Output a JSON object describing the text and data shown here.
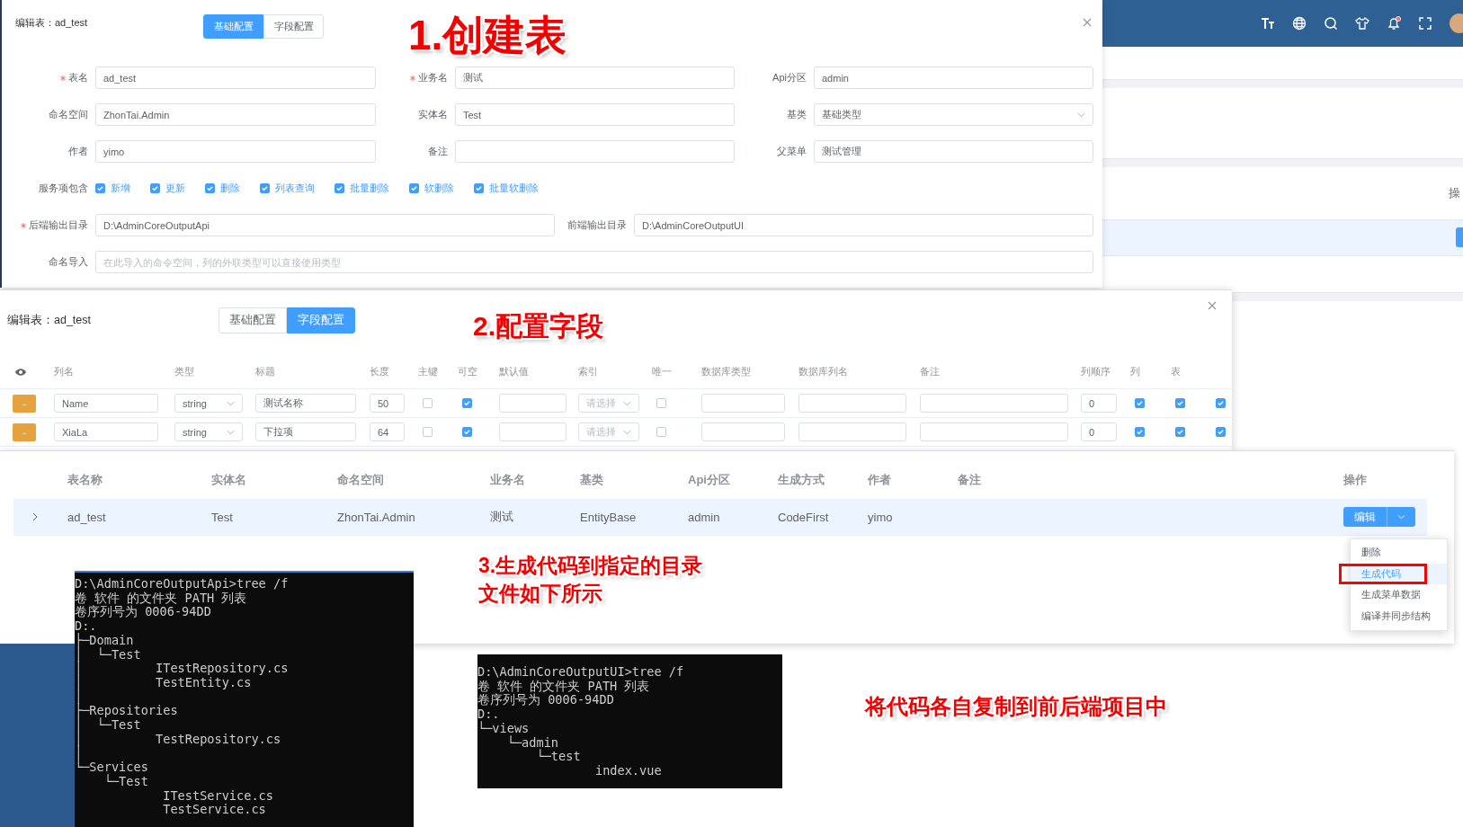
{
  "backdrop": {
    "column_header": "操"
  },
  "basic_config_dialog": {
    "title": "编辑表：ad_test",
    "tabs": [
      {
        "label": "基础配置",
        "selected": true
      },
      {
        "label": "字段配置",
        "selected": false
      }
    ],
    "step_note": "1.创建表",
    "fields": [
      {
        "kind": "input",
        "label": "表名",
        "required": true,
        "value": "ad_test"
      },
      {
        "kind": "input",
        "label": "业务名",
        "required": true,
        "value": "测试"
      },
      {
        "kind": "input",
        "label": "Api分区",
        "required": false,
        "value": "admin"
      },
      {
        "kind": "input",
        "label": "命名空间",
        "required": false,
        "value": "ZhonTai.Admin"
      },
      {
        "kind": "input",
        "label": "实体名",
        "required": false,
        "value": "Test"
      },
      {
        "kind": "select",
        "label": "基类",
        "required": false,
        "value": "基础类型"
      },
      {
        "kind": "input",
        "label": "作者",
        "required": false,
        "value": "yimo"
      },
      {
        "kind": "input",
        "label": "备注",
        "required": false
      },
      {
        "kind": "input",
        "label": "父菜单",
        "required": false,
        "value": "测试管理"
      }
    ],
    "services": {
      "label": "服务项包含",
      "options": [
        {
          "label": "新增",
          "checked": true
        },
        {
          "label": "更新",
          "checked": true
        },
        {
          "label": "删除",
          "checked": true
        },
        {
          "label": "列表查询",
          "checked": true
        },
        {
          "label": "批量删除",
          "checked": true
        },
        {
          "label": "软删除",
          "checked": true
        },
        {
          "label": "批量软删除",
          "checked": true
        }
      ]
    },
    "output_dirs": [
      {
        "label": "后端输出目录",
        "required": true,
        "value": "D:\\AdminCoreOutputApi"
      },
      {
        "label": "前端输出目录",
        "required": false,
        "value": "D:\\AdminCoreOutputUI"
      }
    ],
    "namespace_import": {
      "label": "命名导入",
      "placeholder": "在此导入的命令空间，列的外联类型可以直接使用类型"
    }
  },
  "field_config_dialog": {
    "title": "编辑表：ad_test",
    "tabs": [
      {
        "label": "基础配置",
        "selected": false
      },
      {
        "label": "字段配置",
        "selected": true
      }
    ],
    "step_note": "2.配置字段",
    "columns": [
      "列名",
      "类型",
      "标题",
      "长度",
      "主键",
      "可空",
      "默认值",
      "索引",
      "唯一",
      "数据库类型",
      "数据库列名",
      "备注",
      "列顺序",
      "列",
      "表"
    ],
    "rows": [
      {
        "remove_label": "-",
        "name": "Name",
        "type": "string",
        "title": "测试名称",
        "length": "50",
        "primary_key": false,
        "nullable": true,
        "index_placeholder": "请选择",
        "unique": false,
        "order": "0",
        "column": true,
        "table": true,
        "column_17": true
      },
      {
        "remove_label": "-",
        "name": "XiaLa",
        "type": "string",
        "title": "下拉项",
        "length": "64",
        "primary_key": false,
        "nullable": true,
        "index_placeholder": "请选择",
        "unique": false,
        "order": "0",
        "column": true,
        "table": true,
        "column_17": true
      }
    ]
  },
  "table_list": {
    "columns": [
      "表名称",
      "实体名",
      "命名空间",
      "业务名",
      "基类",
      "Api分区",
      "生成方式",
      "作者",
      "备注",
      "操作"
    ],
    "rows": [
      {
        "expanded": false,
        "cells": [
          "ad_test",
          "Test",
          "ZhonTai.Admin",
          "测试",
          "EntityBase",
          "admin",
          "CodeFirst",
          "yimo"
        ],
        "edit_button": "编辑"
      }
    ],
    "menu": [
      {
        "label": "删除",
        "selected": false
      },
      {
        "label": "生成代码",
        "selected": true
      },
      {
        "label": "生成菜单数据",
        "selected": false
      },
      {
        "label": "编译并同步结构",
        "selected": false
      }
    ],
    "step_note_lines": [
      "3.生成代码到指定的目录",
      "文件如下所示"
    ]
  },
  "terminals": [
    {
      "lines": [
        "D:\\AdminCoreOutputApi>tree /f",
        "卷 软件 的文件夹 PATH 列表",
        "卷序列号为 0006-94DD",
        "D:.",
        "├─Domain",
        "│  └─Test",
        "│          ITestRepository.cs",
        "│          TestEntity.cs",
        "│",
        "├─Repositories",
        "│  └─Test",
        "│          TestRepository.cs",
        "│",
        "└─Services",
        "    └─Test",
        "            ITestService.cs",
        "            TestService.cs"
      ]
    },
    {
      "lines": [
        "D:\\AdminCoreOutputUI>tree /f",
        "卷 软件 的文件夹 PATH 列表",
        "卷序列号为 0006-94DD",
        "D:.",
        "└─views",
        "    └─admin",
        "        └─test",
        "                index.vue"
      ]
    }
  ],
  "final_note": "将代码各自复制到前后端项目中"
}
